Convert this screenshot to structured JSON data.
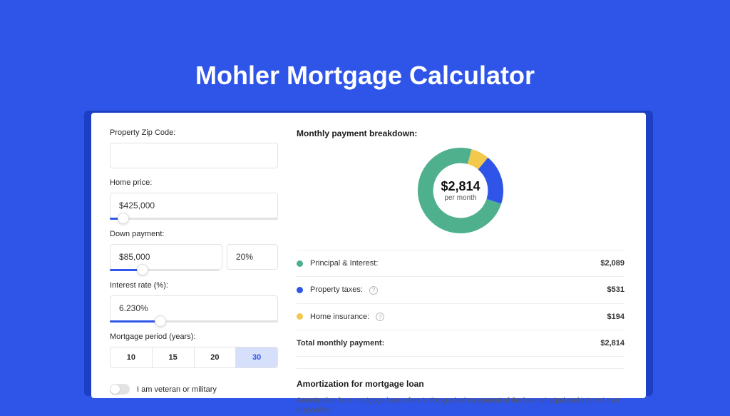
{
  "title": "Mohler Mortgage Calculator",
  "form": {
    "zip": {
      "label": "Property Zip Code:",
      "value": ""
    },
    "price": {
      "label": "Home price:",
      "value": "$425,000",
      "slider_pct": 8
    },
    "down": {
      "label": "Down payment:",
      "amount": "$85,000",
      "pct": "20%",
      "slider_pct": 20
    },
    "rate": {
      "label": "Interest rate (%):",
      "value": "6.230%",
      "slider_pct": 30
    },
    "period": {
      "label": "Mortgage period (years):",
      "options": [
        "10",
        "15",
        "20",
        "30"
      ],
      "selected": "30"
    },
    "veteran": {
      "label": "I am veteran or military",
      "on": false
    }
  },
  "breakdown": {
    "title": "Monthly payment breakdown:",
    "center_amount": "$2,814",
    "center_sub": "per month",
    "items": [
      {
        "name": "Principal & Interest:",
        "value": "$2,089",
        "color": "#4fb08d",
        "help": false
      },
      {
        "name": "Property taxes:",
        "value": "$531",
        "color": "#2f55e8",
        "help": true
      },
      {
        "name": "Home insurance:",
        "value": "$194",
        "color": "#f2c94c",
        "help": true
      }
    ],
    "total": {
      "name": "Total monthly payment:",
      "value": "$2,814"
    }
  },
  "chart_data": {
    "type": "pie",
    "title": "Monthly payment breakdown",
    "series": [
      {
        "name": "Principal & Interest",
        "value": 2089,
        "color": "#4fb08d"
      },
      {
        "name": "Property taxes",
        "value": 531,
        "color": "#2f55e8"
      },
      {
        "name": "Home insurance",
        "value": 194,
        "color": "#f2c94c"
      }
    ],
    "total": 2814
  },
  "amortization": {
    "title": "Amortization for mortgage loan",
    "text": "Amortization for a mortgage loan refers to the gradual repayment of the loan principal and interest over a specified"
  }
}
